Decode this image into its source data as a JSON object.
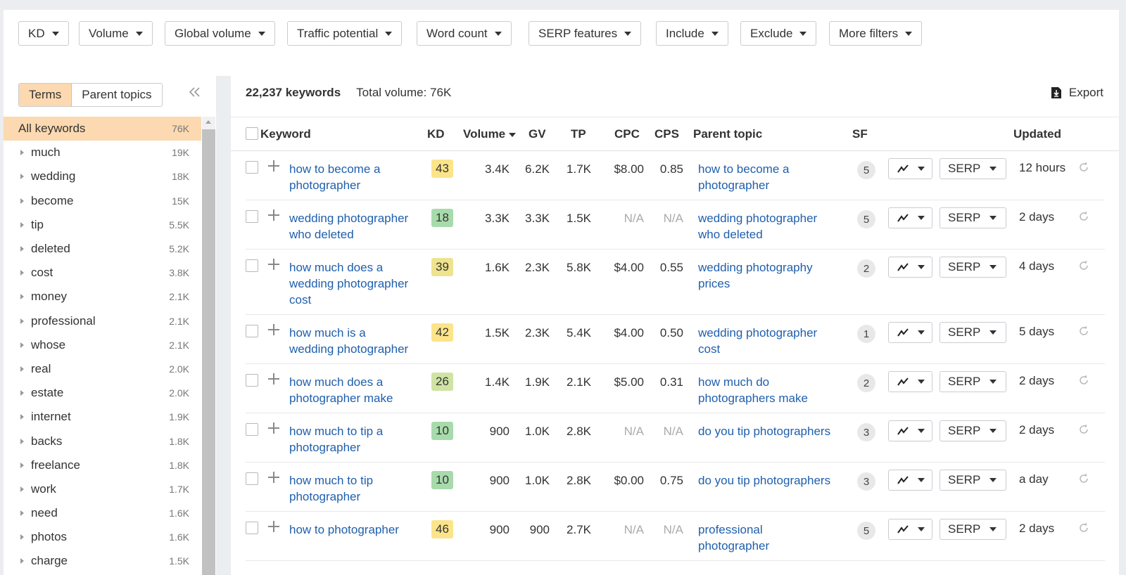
{
  "filters": [
    "KD",
    "Volume",
    "Global volume",
    "Traffic potential",
    "Word count",
    "SERP features",
    "Include",
    "Exclude",
    "More filters"
  ],
  "sidebar": {
    "tabs": [
      "Terms",
      "Parent topics"
    ],
    "all": {
      "label": "All keywords",
      "count": "76K"
    },
    "items": [
      {
        "label": "much",
        "count": "19K"
      },
      {
        "label": "wedding",
        "count": "18K"
      },
      {
        "label": "become",
        "count": "15K"
      },
      {
        "label": "tip",
        "count": "5.5K"
      },
      {
        "label": "deleted",
        "count": "5.2K"
      },
      {
        "label": "cost",
        "count": "3.8K"
      },
      {
        "label": "money",
        "count": "2.1K"
      },
      {
        "label": "professional",
        "count": "2.1K"
      },
      {
        "label": "whose",
        "count": "2.1K"
      },
      {
        "label": "real",
        "count": "2.0K"
      },
      {
        "label": "estate",
        "count": "2.0K"
      },
      {
        "label": "internet",
        "count": "1.9K"
      },
      {
        "label": "backs",
        "count": "1.8K"
      },
      {
        "label": "freelance",
        "count": "1.8K"
      },
      {
        "label": "work",
        "count": "1.7K"
      },
      {
        "label": "need",
        "count": "1.6K"
      },
      {
        "label": "photos",
        "count": "1.6K"
      },
      {
        "label": "charge",
        "count": "1.5K"
      }
    ]
  },
  "summary": {
    "keywords": "22,237 keywords",
    "total": "Total volume: 76K"
  },
  "export_label": "Export",
  "columns": {
    "keyword": "Keyword",
    "kd": "KD",
    "volume": "Volume",
    "gv": "GV",
    "tp": "TP",
    "cpc": "CPC",
    "cps": "CPS",
    "parent": "Parent topic",
    "sf": "SF",
    "updated": "Updated"
  },
  "serp_label": "SERP",
  "kd_colors": {
    "yellow": "#fbe48a",
    "lightgreen": "#cfe3a3",
    "green": "#a8dbab"
  },
  "rows": [
    {
      "keyword": [
        "how to become a",
        "photographer"
      ],
      "kd": "43",
      "kd_color": "#fbe48a",
      "volume": "3.4K",
      "gv": "6.2K",
      "tp": "1.7K",
      "cpc": "$8.00",
      "cps": "0.85",
      "parent": [
        "how to become a",
        "photographer"
      ],
      "sf": "5",
      "updated": "12 hours"
    },
    {
      "keyword": [
        "wedding photographer",
        "who deleted"
      ],
      "kd": "18",
      "kd_color": "#a8dbab",
      "volume": "3.3K",
      "gv": "3.3K",
      "tp": "1.5K",
      "cpc": "N/A",
      "cps": "N/A",
      "parent": [
        "wedding photographer",
        "who deleted"
      ],
      "sf": "5",
      "updated": "2 days"
    },
    {
      "keyword": [
        "how much does a",
        "wedding photographer",
        "cost"
      ],
      "kd": "39",
      "kd_color": "#eee38e",
      "volume": "1.6K",
      "gv": "2.3K",
      "tp": "5.8K",
      "cpc": "$4.00",
      "cps": "0.55",
      "parent": [
        "wedding photography",
        "prices"
      ],
      "sf": "2",
      "updated": "4 days"
    },
    {
      "keyword": [
        "how much is a",
        "wedding photographer"
      ],
      "kd": "42",
      "kd_color": "#fbe48a",
      "volume": "1.5K",
      "gv": "2.3K",
      "tp": "5.4K",
      "cpc": "$4.00",
      "cps": "0.50",
      "parent": [
        "wedding photographer",
        "cost"
      ],
      "sf": "1",
      "updated": "5 days"
    },
    {
      "keyword": [
        "how much does a",
        "photographer make"
      ],
      "kd": "26",
      "kd_color": "#cfe3a3",
      "volume": "1.4K",
      "gv": "1.9K",
      "tp": "2.1K",
      "cpc": "$5.00",
      "cps": "0.31",
      "parent": [
        "how much do",
        "photographers make"
      ],
      "sf": "2",
      "updated": "2 days"
    },
    {
      "keyword": [
        "how much to tip a",
        "photographer"
      ],
      "kd": "10",
      "kd_color": "#a8dbab",
      "volume": "900",
      "gv": "1.0K",
      "tp": "2.8K",
      "cpc": "N/A",
      "cps": "N/A",
      "parent": [
        "do you tip photographers"
      ],
      "sf": "3",
      "updated": "2 days"
    },
    {
      "keyword": [
        "how much to tip",
        "photographer"
      ],
      "kd": "10",
      "kd_color": "#a8dbab",
      "volume": "900",
      "gv": "1.0K",
      "tp": "2.8K",
      "cpc": "$0.00",
      "cps": "0.75",
      "parent": [
        "do you tip photographers"
      ],
      "sf": "3",
      "updated": "a day"
    },
    {
      "keyword": [
        "how to photographer"
      ],
      "kd": "46",
      "kd_color": "#fbe48a",
      "volume": "900",
      "gv": "900",
      "tp": "2.7K",
      "cpc": "N/A",
      "cps": "N/A",
      "parent": [
        "professional",
        "photographer"
      ],
      "sf": "5",
      "updated": "2 days"
    }
  ]
}
